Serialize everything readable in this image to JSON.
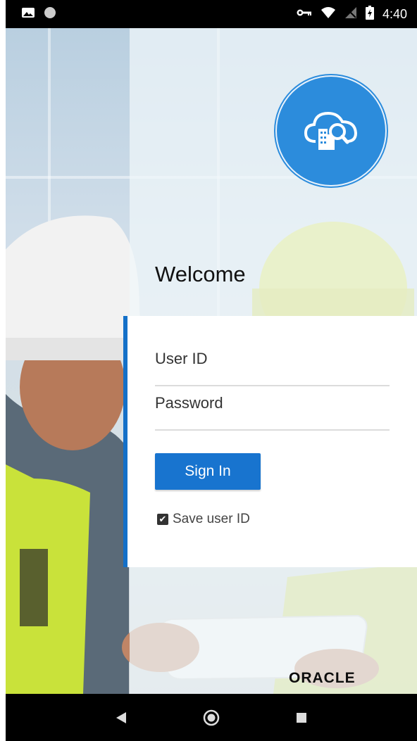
{
  "status_bar": {
    "time": "4:40",
    "icons": [
      "image-icon",
      "circle-icon",
      "key-icon",
      "wifi-icon",
      "no-signal-icon",
      "battery-icon"
    ]
  },
  "login": {
    "welcome": "Welcome",
    "user_id_placeholder": "User ID",
    "password_placeholder": "Password",
    "sign_in_label": "Sign In",
    "save_user_id_label": "Save user ID",
    "save_user_id_checked": true
  },
  "brand": {
    "name": "ORACLE"
  },
  "colors": {
    "accent": "#1874cf",
    "logo": "#2c8cdc"
  },
  "nav_bar": {
    "icons": [
      "back-icon",
      "home-icon",
      "recents-icon"
    ]
  }
}
